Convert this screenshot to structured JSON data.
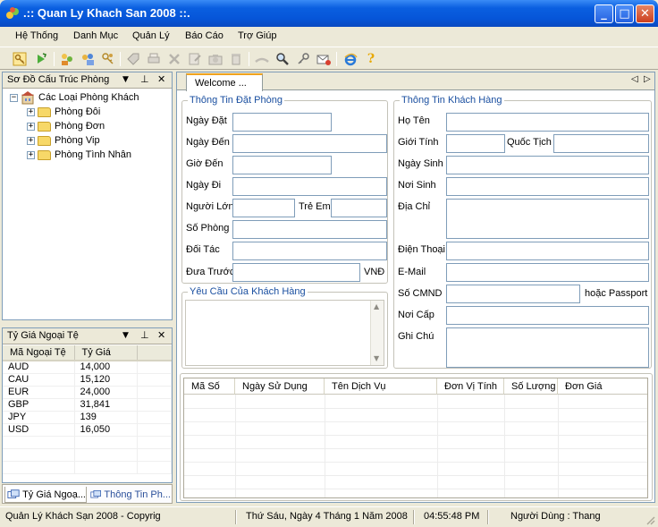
{
  "window": {
    "title": ".:: Quan Ly Khach San 2008 ::."
  },
  "menu": [
    "Hệ Thống",
    "Danh Mục",
    "Quản Lý",
    "Báo Cáo",
    "Trợ Giúp"
  ],
  "toolbar_icons": [
    "key-icon",
    "refresh-icon",
    "users-icon",
    "guests-icon",
    "keys-icon",
    "tag-icon",
    "print-icon",
    "delete-icon",
    "edit-icon",
    "camera-icon",
    "trash-icon",
    "bar-icon",
    "search-icon",
    "key-search-icon",
    "mail-icon",
    "ie-icon",
    "help-icon"
  ],
  "tree_panel": {
    "title": "Sơ Đồ Cấu Trúc Phòng",
    "root": "Các Loại Phòng Khách",
    "items": [
      "Phòng Đôi",
      "Phòng Đơn",
      "Phòng Vip",
      "Phòng Tình Nhân"
    ]
  },
  "rate_panel": {
    "title": "Tỷ Giá Ngoại Tệ",
    "columns": [
      "Mã Ngoại Tệ",
      "Tỷ Giá"
    ],
    "rows": [
      [
        "AUD",
        "14,000"
      ],
      [
        "CAU",
        "15,120"
      ],
      [
        "EUR",
        "24,000"
      ],
      [
        "GBP",
        "31,841"
      ],
      [
        "JPY",
        "139"
      ],
      [
        "USD",
        "16,050"
      ]
    ]
  },
  "bottom_tabs": [
    "Tỷ Giá Ngoạ...",
    "Thông Tin Ph..."
  ],
  "content_tab": "Welcome ...",
  "booking": {
    "title": "Thông Tin Đặt Phòng",
    "labels": {
      "ngay_dat": "Ngày Đặt",
      "ngay_den": "Ngày Đến",
      "gio_den": "Giờ Đến",
      "ngay_di": "Ngày Đi",
      "nguoi_lon": "Người Lớn",
      "tre_em": "Trẻ Em",
      "so_phong": "Số Phòng",
      "doi_tac": "Đối Tác",
      "dua_truoc": "Đưa Trước",
      "currency": "VNĐ"
    }
  },
  "customer": {
    "title": "Thông Tin Khách Hàng",
    "labels": {
      "ho_ten": "Họ Tên",
      "gioi_tinh": "Giới Tính",
      "quoc_tich": "Quốc Tịch",
      "ngay_sinh": "Ngày Sinh",
      "noi_sinh": "Nơi Sinh",
      "dia_chi": "Địa Chỉ",
      "dien_thoai": "Điện Thoại",
      "email": "E-Mail",
      "so_cmnd": "Số CMND",
      "passport": "hoặc Passport",
      "noi_cap": "Nơi Cấp",
      "ghi_chu": "Ghi Chú"
    }
  },
  "request": {
    "title": "Yêu Cầu Của Khách Hàng"
  },
  "services_grid": {
    "columns": [
      "Mã Số",
      "Ngày Sử Dụng",
      "Tên Dịch Vụ",
      "Đơn Vị Tính",
      "Số Lượng",
      "Đơn Giá"
    ]
  },
  "status": {
    "app": "Quản Lý Khách Sạn 2008 - Copyrig",
    "date": "Thứ Sáu, Ngày 4 Tháng 1 Năm 2008",
    "time": "04:55:48 PM",
    "user": "Người Dùng : Thang"
  },
  "colors": {
    "titlebar": "#0655d8",
    "group_title": "#1a4fa0",
    "tab_accent": "#f0a31e"
  }
}
